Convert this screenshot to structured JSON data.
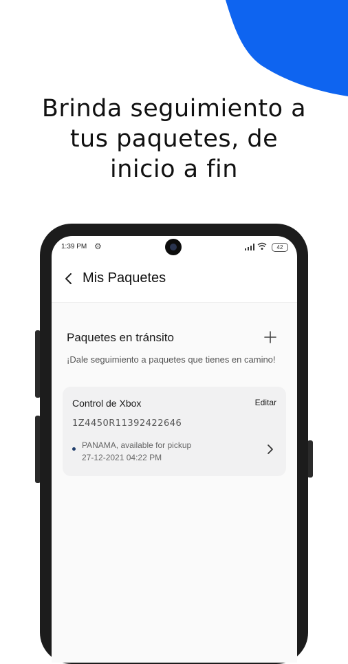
{
  "headline": {
    "line1": "Brinda seguimiento a",
    "line2": "tus paquetes, de",
    "line3": "inicio a fin"
  },
  "colors": {
    "accent": "#0e64f0",
    "dot": "#1f3d6b",
    "card": "#f1f1f2"
  },
  "status_bar": {
    "time": "1:39 PM",
    "battery": "42"
  },
  "app_bar": {
    "title": "Mis Paquetes"
  },
  "section": {
    "title": "Paquetes en tránsito",
    "subtitle": "¡Dale seguimiento a paquetes que tienes en camino!"
  },
  "package": {
    "name": "Control de Xbox",
    "edit_label": "Editar",
    "tracking": "1Z4450R11392422646",
    "status": "PANAMA, available for pickup",
    "date": "27-12-2021 04:22 PM"
  },
  "icons": [
    "gear-icon",
    "camera-icon",
    "signal-icon",
    "wifi-icon",
    "battery-icon",
    "back-chevron-icon",
    "plus-icon",
    "chevron-right-icon"
  ]
}
